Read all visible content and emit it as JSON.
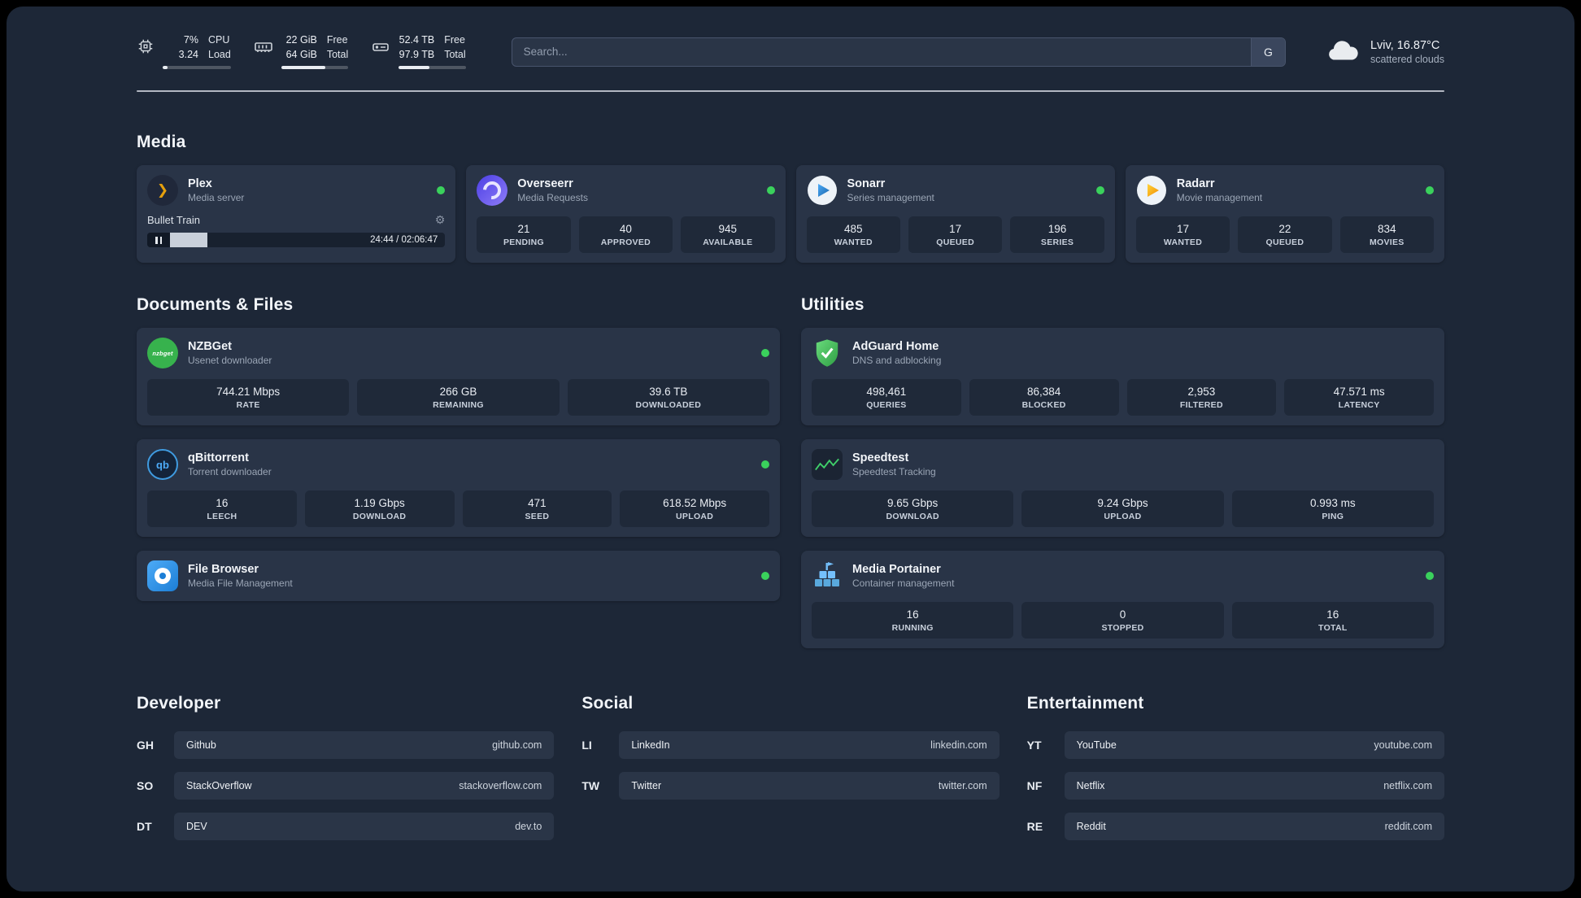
{
  "colors": {
    "status_online": "#3ad15c",
    "plex_accent": "#e5a00d",
    "sonarr_accent": "#35a8f4",
    "radarr_accent": "#f5a623"
  },
  "header": {
    "metrics": [
      {
        "line1_value": "7%",
        "line2_value": "3.24",
        "line1_label": "CPU",
        "line2_label": "Load",
        "progress_pct": 7
      },
      {
        "line1_value": "22 GiB",
        "line2_value": "64 GiB",
        "line1_label": "Free",
        "line2_label": "Total",
        "progress_pct": 66
      },
      {
        "line1_value": "52.4 TB",
        "line2_value": "97.9 TB",
        "line1_label": "Free",
        "line2_label": "Total",
        "progress_pct": 46
      }
    ],
    "search": {
      "placeholder": "Search...",
      "engine_label": "G"
    },
    "weather": {
      "location": "Lviv, 16.87°C",
      "condition": "scattered clouds"
    }
  },
  "sections": {
    "media": {
      "title": "Media",
      "plex": {
        "name": "Plex",
        "subtitle": "Media server",
        "status": "online",
        "now_playing": {
          "title": "Bullet Train",
          "time_display": "24:44 / 02:06:47",
          "progress_pct": 19.5
        }
      },
      "overseerr": {
        "name": "Overseerr",
        "subtitle": "Media Requests",
        "status": "online",
        "stats": [
          {
            "value": "21",
            "label": "PENDING"
          },
          {
            "value": "40",
            "label": "APPROVED"
          },
          {
            "value": "945",
            "label": "AVAILABLE"
          }
        ]
      },
      "sonarr": {
        "name": "Sonarr",
        "subtitle": "Series management",
        "status": "online",
        "stats": [
          {
            "value": "485",
            "label": "WANTED"
          },
          {
            "value": "17",
            "label": "QUEUED"
          },
          {
            "value": "196",
            "label": "SERIES"
          }
        ]
      },
      "radarr": {
        "name": "Radarr",
        "subtitle": "Movie management",
        "status": "online",
        "stats": [
          {
            "value": "17",
            "label": "WANTED"
          },
          {
            "value": "22",
            "label": "QUEUED"
          },
          {
            "value": "834",
            "label": "MOVIES"
          }
        ]
      }
    },
    "documents": {
      "title": "Documents & Files",
      "nzbget": {
        "name": "NZBGet",
        "subtitle": "Usenet downloader",
        "status": "online",
        "icon_text": "nzbget",
        "stats": [
          {
            "value": "744.21 Mbps",
            "label": "RATE"
          },
          {
            "value": "266 GB",
            "label": "REMAINING"
          },
          {
            "value": "39.6 TB",
            "label": "DOWNLOADED"
          }
        ]
      },
      "qbittorrent": {
        "name": "qBittorrent",
        "subtitle": "Torrent downloader",
        "status": "online",
        "icon_text": "qb",
        "stats": [
          {
            "value": "16",
            "label": "LEECH"
          },
          {
            "value": "1.19 Gbps",
            "label": "DOWNLOAD"
          },
          {
            "value": "471",
            "label": "SEED"
          },
          {
            "value": "618.52 Mbps",
            "label": "UPLOAD"
          }
        ]
      },
      "filebrowser": {
        "name": "File Browser",
        "subtitle": "Media File Management",
        "status": "online"
      }
    },
    "utilities": {
      "title": "Utilities",
      "adguard": {
        "name": "AdGuard Home",
        "subtitle": "DNS and adblocking",
        "stats": [
          {
            "value": "498,461",
            "label": "QUERIES"
          },
          {
            "value": "86,384",
            "label": "BLOCKED"
          },
          {
            "value": "2,953",
            "label": "FILTERED"
          },
          {
            "value": "47.571 ms",
            "label": "LATENCY"
          }
        ]
      },
      "speedtest": {
        "name": "Speedtest",
        "subtitle": "Speedtest Tracking",
        "stats": [
          {
            "value": "9.65 Gbps",
            "label": "DOWNLOAD"
          },
          {
            "value": "9.24 Gbps",
            "label": "UPLOAD"
          },
          {
            "value": "0.993 ms",
            "label": "PING"
          }
        ]
      },
      "portainer": {
        "name": "Media Portainer",
        "subtitle": "Container management",
        "status": "online",
        "stats": [
          {
            "value": "16",
            "label": "RUNNING"
          },
          {
            "value": "0",
            "label": "STOPPED"
          },
          {
            "value": "16",
            "label": "TOTAL"
          }
        ]
      }
    },
    "developer": {
      "title": "Developer",
      "bookmarks": [
        {
          "abbr": "GH",
          "name": "Github",
          "url": "github.com"
        },
        {
          "abbr": "SO",
          "name": "StackOverflow",
          "url": "stackoverflow.com"
        },
        {
          "abbr": "DT",
          "name": "DEV",
          "url": "dev.to"
        }
      ]
    },
    "social": {
      "title": "Social",
      "bookmarks": [
        {
          "abbr": "LI",
          "name": "LinkedIn",
          "url": "linkedin.com"
        },
        {
          "abbr": "TW",
          "name": "Twitter",
          "url": "twitter.com"
        }
      ]
    },
    "entertainment": {
      "title": "Entertainment",
      "bookmarks": [
        {
          "abbr": "YT",
          "name": "YouTube",
          "url": "youtube.com"
        },
        {
          "abbr": "NF",
          "name": "Netflix",
          "url": "netflix.com"
        },
        {
          "abbr": "RE",
          "name": "Reddit",
          "url": "reddit.com"
        }
      ]
    }
  }
}
